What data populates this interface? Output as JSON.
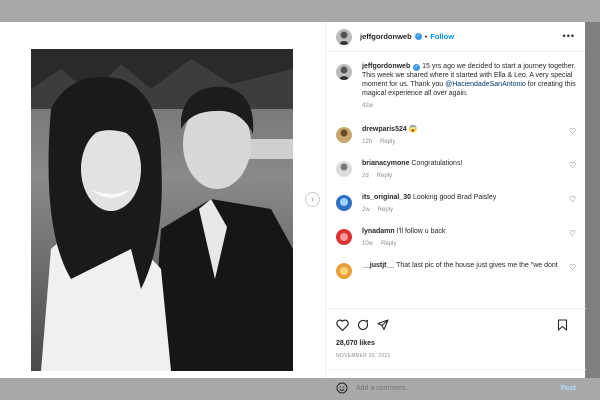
{
  "post": {
    "username": "jeffgordonweb",
    "follow_label": "Follow",
    "dot": "•",
    "more": "•••",
    "caption_pre": " 15 yrs ago we decided to start a journey together. This week we shared where it started with Ella & Leo. A very special moment for us. Thank you ",
    "caption_mention": "@HaciendadeSanAntonio",
    "caption_post": " for creating this magical experience all over again.",
    "caption_time": "42w"
  },
  "comments": [
    {
      "user": "drewparis524",
      "text": " 😱",
      "time": "12h",
      "reply": "Reply"
    },
    {
      "user": "brianacymone",
      "text": " Congratulations!",
      "time": "2d",
      "reply": "Reply"
    },
    {
      "user": "its_original_30",
      "text": " Looking good Brad Paisley",
      "time": "2w",
      "reply": "Reply"
    },
    {
      "user": "lynadamn",
      "text": " I'll follow u back",
      "time": "10w",
      "reply": "Reply"
    },
    {
      "user": "__justjt__",
      "text": " That last pic of the house just gives me the \"we dont",
      "time": "",
      "reply": ""
    }
  ],
  "stats": {
    "likes": "28,070 likes",
    "date": "NOVEMBER 25, 2021"
  },
  "composer": {
    "placeholder": "Add a comment...",
    "post_label": "Post"
  },
  "icons": [
    "verified-icon",
    "more-icon",
    "heart-icon",
    "comment-icon",
    "share-icon",
    "bookmark-icon",
    "emoji-icon",
    "chevron-right-icon"
  ]
}
